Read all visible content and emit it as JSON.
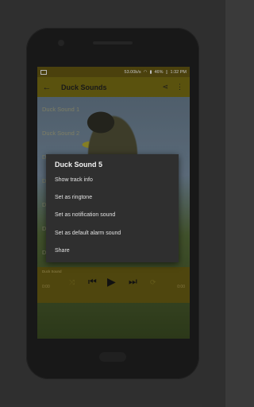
{
  "status_bar": {
    "speed": "53.00b/s",
    "battery": "46%",
    "time": "1:32 PM"
  },
  "app_bar": {
    "title": "Duck Sounds",
    "back_icon": "arrow-back-icon",
    "share_icon": "share-icon",
    "menu_icon": "more-vert-icon"
  },
  "list": {
    "items": [
      {
        "label": "Duck Sound 1"
      },
      {
        "label": "Duck Sound 2"
      },
      {
        "label": "D"
      },
      {
        "label": "D"
      },
      {
        "label": "D"
      },
      {
        "label": "D"
      },
      {
        "label": "D"
      }
    ]
  },
  "player": {
    "now_playing": "Duck Sound",
    "time_elapsed": "0:00",
    "time_total": "0:00"
  },
  "dialog": {
    "title": "Duck Sound 5",
    "options": [
      {
        "label": "Show track info"
      },
      {
        "label": "Set as ringtone"
      },
      {
        "label": "Set as notification sound"
      },
      {
        "label": "Set as default alarm sound"
      },
      {
        "label": "Share"
      }
    ]
  }
}
